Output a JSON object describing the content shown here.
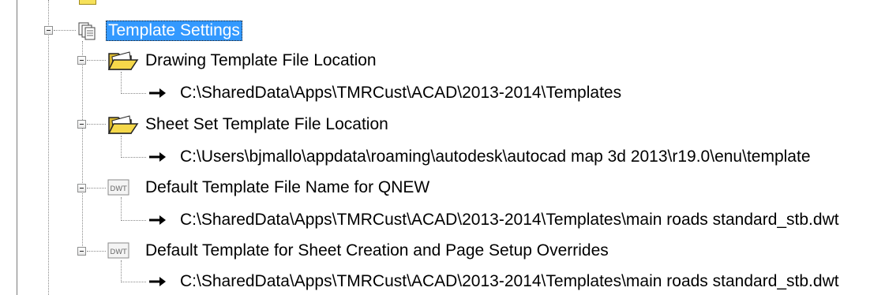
{
  "tree": {
    "root": {
      "label": "Template Settings",
      "icon": "template-settings-icon",
      "selected": true
    },
    "items": [
      {
        "label": "Drawing Template File Location",
        "icon": "folder-open-icon",
        "value": "C:\\SharedData\\Apps\\TMRCust\\ACAD\\2013-2014\\Templates"
      },
      {
        "label": "Sheet Set Template File Location",
        "icon": "folder-open-icon",
        "value": "C:\\Users\\bjmallo\\appdata\\roaming\\autodesk\\autocad map 3d 2013\\r19.0\\enu\\template"
      },
      {
        "label": "Default Template File Name for QNEW",
        "icon": "dwt-file-icon",
        "value": "C:\\SharedData\\Apps\\TMRCust\\ACAD\\2013-2014\\Templates\\main roads standard_stb.dwt"
      },
      {
        "label": "Default Template for Sheet Creation and Page Setup Overrides",
        "icon": "dwt-file-icon",
        "value": "C:\\SharedData\\Apps\\TMRCust\\ACAD\\2013-2014\\Templates\\main roads standard_stb.dwt"
      }
    ],
    "colors": {
      "selection": "#3399ff",
      "folder": "#f5d84a"
    }
  }
}
